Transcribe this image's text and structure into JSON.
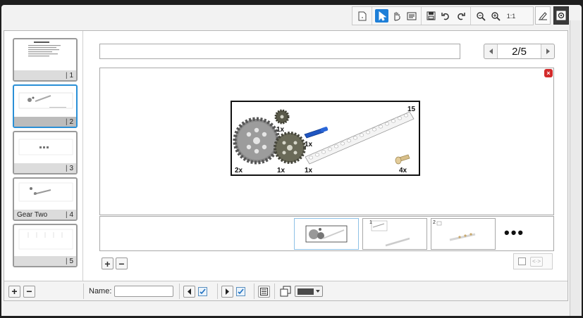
{
  "toolbar": {
    "icons": [
      "new-page-icon",
      "pointer-icon",
      "hand-icon",
      "text-panel-icon",
      "save-icon",
      "undo-icon",
      "redo-icon",
      "zoom-out-icon",
      "zoom-in-icon"
    ],
    "actual_size_label": "1:1",
    "accent": "#1e7fd8"
  },
  "side_tabs": [
    "edit-tab-icon",
    "settings-tab-icon"
  ],
  "thumbnails": [
    {
      "label": "",
      "num": "1",
      "selected": false
    },
    {
      "label": "",
      "num": "2",
      "selected": true
    },
    {
      "label": "",
      "num": "3",
      "selected": false
    },
    {
      "label": "Gear Two",
      "num": "4",
      "selected": false
    },
    {
      "label": "",
      "num": "5",
      "selected": false
    }
  ],
  "thumbs_controls": {
    "add": "+",
    "remove": "−"
  },
  "title_field": {
    "value": ""
  },
  "pager": {
    "current": "2/5"
  },
  "stage": {
    "close_icon": "×",
    "parts_image": {
      "step_number": "15",
      "parts": [
        {
          "name": "large-gear",
          "qty": "2x"
        },
        {
          "name": "small-gear",
          "qty": "1x"
        },
        {
          "name": "medium-gear",
          "qty": "1x"
        },
        {
          "name": "axle-pin",
          "qty": "1x"
        },
        {
          "name": "beam",
          "qty": "1x"
        },
        {
          "name": "connector-peg",
          "qty": "4x"
        }
      ]
    }
  },
  "strip": {
    "items": [
      {
        "badge": "",
        "selected": true
      },
      {
        "badge": "1",
        "selected": false
      },
      {
        "badge": "2",
        "selected": false
      }
    ],
    "more_label": "•••"
  },
  "strip_controls": {
    "add": "+",
    "remove": "−"
  },
  "code_toggle": {
    "label": "<·>"
  },
  "bottombar": {
    "thumbs_add": "+",
    "thumbs_remove": "−",
    "name_label": "Name:",
    "name_value": "",
    "color_swatch": "#4a4a4a"
  }
}
